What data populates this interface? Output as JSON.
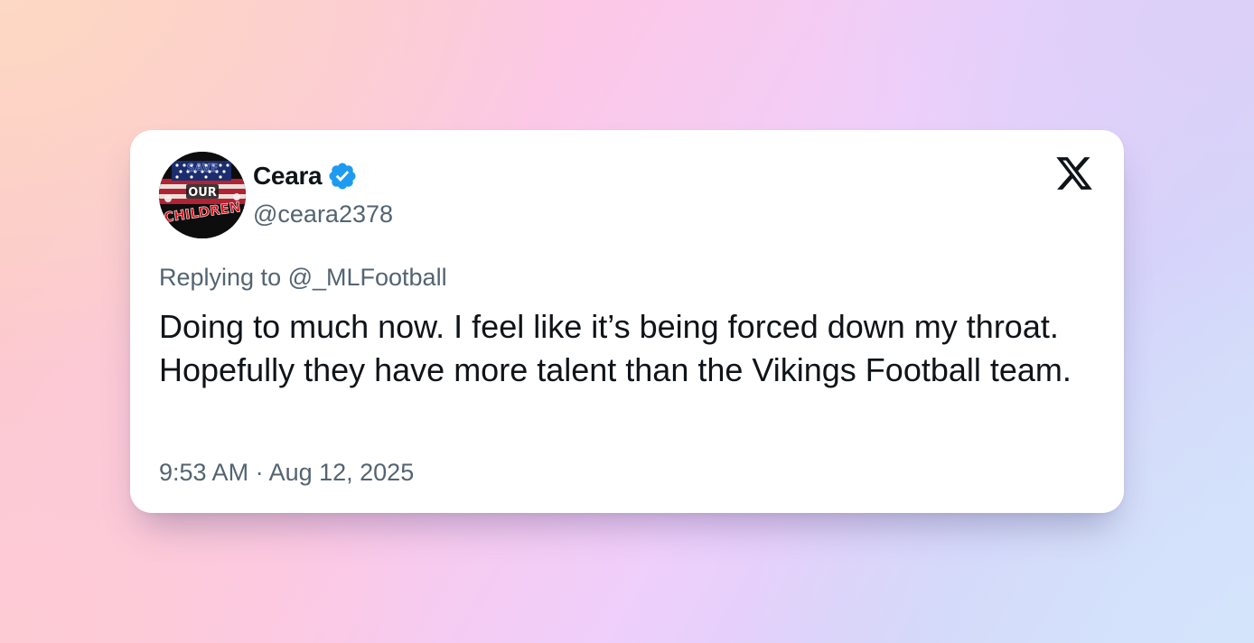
{
  "tweet": {
    "display_name": "Ceara",
    "handle": "@ceara2378",
    "verified": true,
    "verified_icon": "verified-badge-icon",
    "avatar": {
      "icon": "save-our-children-avatar",
      "text_lines": [
        "SAVE",
        "OUR",
        "CHILDREN"
      ]
    },
    "platform_logo": "x-logo-icon",
    "replying_to": "Replying to @_MLFootball",
    "text": "Doing to much now. I feel like it’s being forced down my throat. Hopefully they have more talent than the Vikings Football team.",
    "timestamp": "9:53 AM · Aug 12, 2025"
  },
  "colors": {
    "primary_text": "#0f1419",
    "secondary_text": "#536471",
    "verified_blue": "#1d9bf0",
    "card_bg": "#ffffff"
  }
}
